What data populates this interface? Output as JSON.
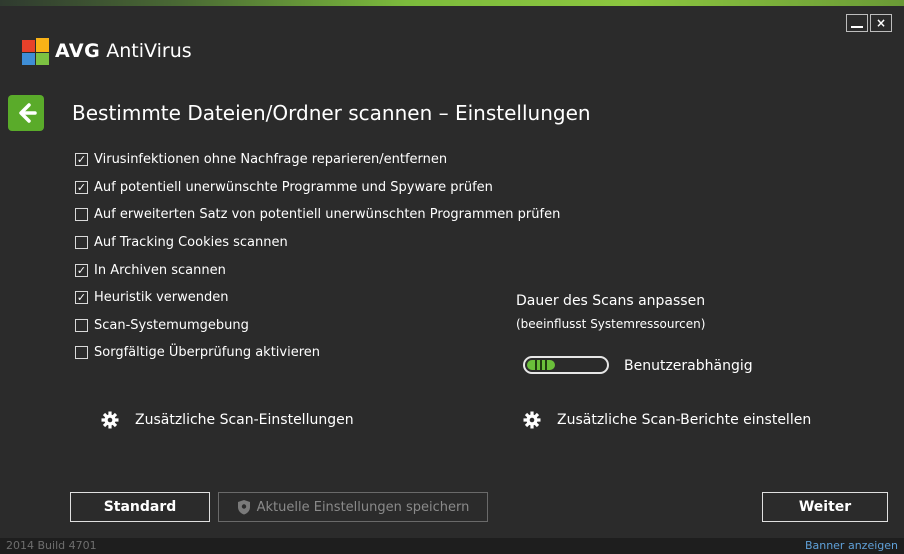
{
  "app": {
    "brand_bold": "AVG",
    "brand_name": "AntiVirus",
    "close_glyph": "×"
  },
  "page": {
    "title": "Bestimmte Dateien/Ordner scannen – Einstellungen"
  },
  "options": [
    {
      "label": "Virusinfektionen ohne Nachfrage reparieren/entfernen",
      "checked": true
    },
    {
      "label": "Auf potentiell unerwünschte Programme und Spyware prüfen",
      "checked": true
    },
    {
      "label": "Auf erweiterten Satz von potentiell unerwünschten Programmen prüfen",
      "checked": false
    },
    {
      "label": "Auf Tracking Cookies scannen",
      "checked": false
    },
    {
      "label": "In Archiven scannen",
      "checked": true
    },
    {
      "label": "Heuristik verwenden",
      "checked": true
    },
    {
      "label": "Scan-Systemumgebung",
      "checked": false
    },
    {
      "label": "Sorgfältige Überprüfung aktivieren",
      "checked": false
    }
  ],
  "duration": {
    "title": "Dauer des Scans anpassen",
    "subtitle": "(beeinflusst Systemressourcen)",
    "value_label": "Benutzerabhängig"
  },
  "links": {
    "extra_settings": "Zusätzliche Scan-Einstellungen",
    "extra_reports": "Zusätzliche Scan-Berichte einstellen"
  },
  "buttons": {
    "standard": "Standard",
    "save": "Aktuelle Einstellungen speichern",
    "next": "Weiter"
  },
  "footer": {
    "build": "2014  Build 4701",
    "banner": "Banner anzeigen"
  },
  "colors": {
    "accent_green": "#5aab2a",
    "background": "#2b2b2b",
    "link_blue": "#5fa0d8"
  },
  "icons": {
    "back": "arrow-left-icon",
    "gear": "gear-icon",
    "shield": "shield-icon",
    "minimize": "minimize-icon",
    "close": "close-icon",
    "logo": "avg-logo"
  }
}
